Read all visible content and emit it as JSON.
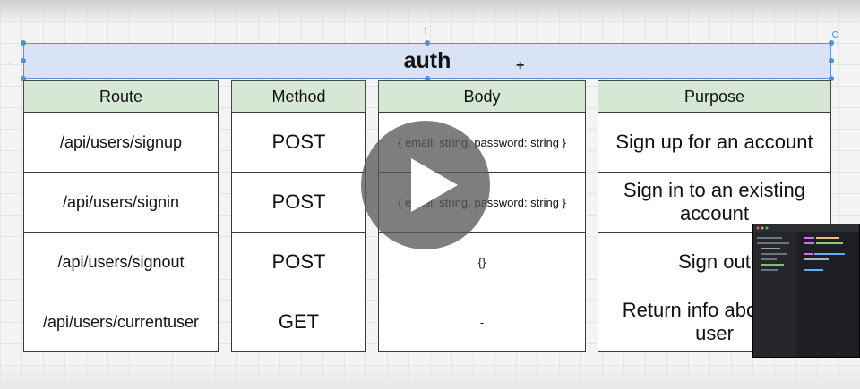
{
  "title": "auth",
  "columns": [
    "Route",
    "Method",
    "Body",
    "Purpose"
  ],
  "rows": [
    {
      "route": "/api/users/signup",
      "method": "POST",
      "body": "{ email: string, password: string }",
      "purpose": "Sign up for an account"
    },
    {
      "route": "/api/users/signin",
      "method": "POST",
      "body": "{ email: string, password: string }",
      "purpose": "Sign in to an existing account"
    },
    {
      "route": "/api/users/signout",
      "method": "POST",
      "body": "{}",
      "purpose": "Sign out"
    },
    {
      "route": "/api/users/currentuser",
      "method": "GET",
      "body": "-",
      "purpose": "Return info about the user"
    }
  ],
  "colors": {
    "header_fill": "#d9e3f6",
    "column_header_fill": "#d5e8d4",
    "selection": "#4a90e2",
    "play_overlay": "#5a5a5a"
  },
  "icons": {
    "play": "play-icon",
    "cursor": "crosshair-cursor-icon"
  }
}
